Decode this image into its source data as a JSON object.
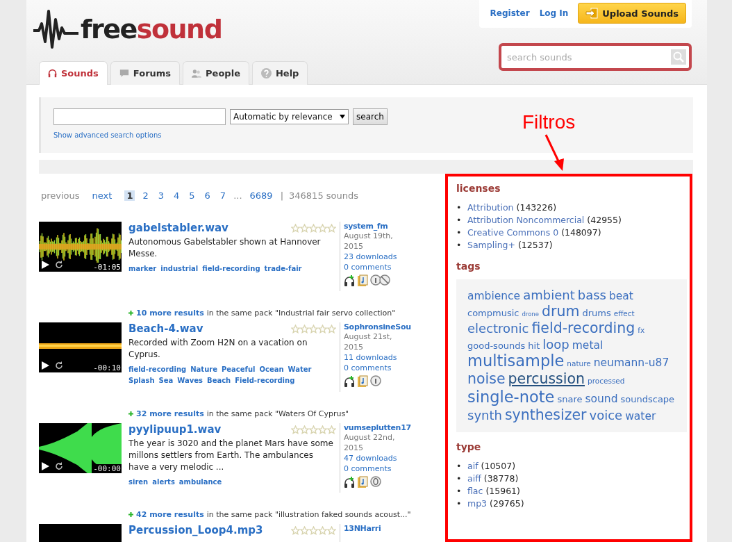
{
  "header": {
    "logo_text": "free",
    "logo_accent": "sound",
    "nav_tabs": [
      {
        "label": "Sounds",
        "selected": true
      },
      {
        "label": "Forums",
        "selected": false
      },
      {
        "label": "People",
        "selected": false
      },
      {
        "label": "Help",
        "selected": false
      }
    ],
    "account_links": [
      "Register",
      "Log In"
    ],
    "upload_button": "Upload Sounds",
    "site_search": {
      "placeholder": "search sounds"
    }
  },
  "search_panel": {
    "sort_select": "Automatic by relevance",
    "search_button": "search",
    "advanced_link": "Show advanced search options"
  },
  "pagination": {
    "previous": {
      "label": "previous",
      "disabled": true
    },
    "next": "next",
    "pages": [
      {
        "label": "1",
        "selected": true
      },
      {
        "label": "2",
        "selected": false
      },
      {
        "label": "3",
        "selected": false
      },
      {
        "label": "4",
        "selected": false
      },
      {
        "label": "5",
        "selected": false
      },
      {
        "label": "6",
        "selected": false
      },
      {
        "label": "7",
        "selected": false
      }
    ],
    "ellipsis": "...",
    "last_page": "6689",
    "separator": "|",
    "total": "346815 sounds"
  },
  "results": [
    {
      "title": "gabelstabler.wav",
      "stars": 0,
      "waveform": {
        "kind": "noisy"
      },
      "duration": "-01:05",
      "description": "Autonomous Gabelstabler shown at Hannover Messe.",
      "tags": [
        "marker",
        "industrial",
        "field-recording",
        "trade-fair"
      ],
      "user": "system_fm",
      "date": "August 19th, 2015",
      "downloads": "23 downloads",
      "comments": "0 comments",
      "license": {
        "kind": "noncommercial"
      },
      "more": {
        "count": "10 more results",
        "rest": "in the same pack \"Industrial fair servo collection\""
      }
    },
    {
      "title": "Beach-4.wav",
      "stars": 0,
      "waveform": {
        "kind": "flat"
      },
      "duration": "-00:10",
      "description": "Recorded with Zoom H2N on a vacation on Cyprus.",
      "tags": [
        "field-recording",
        "Nature",
        "Peaceful",
        "Ocean",
        "Water",
        "Splash",
        "Sea",
        "Waves",
        "Beach",
        "Field-recording"
      ],
      "user": "SophronsineSou",
      "date": "August 21st, 2015",
      "downloads": "11 downloads",
      "comments": "0 comments",
      "license": {
        "kind": "attribution"
      },
      "more": {
        "count": "32 more results",
        "rest": "in the same pack \"Waters Of Cyprus\""
      }
    },
    {
      "title": "pyylipuup1.wav",
      "stars": 0,
      "waveform": {
        "kind": "tone"
      },
      "duration": "-00:00",
      "description": "The year is 3020 and the planet Mars have some millons settlers from Earth. The ambulances have a very melodic ...",
      "tags": [
        "siren",
        "alerts",
        "ambulance"
      ],
      "user": "vumseplutten17",
      "date": "August 22nd, 2015",
      "downloads": "47 downloads",
      "comments": "0 comments",
      "license": {
        "kind": "zero"
      },
      "more": {
        "count": "42 more results",
        "rest": "in the same pack \"illustration faked sounds acoust...\""
      }
    },
    {
      "title": "Percussion_Loop4.mp3",
      "stars": 0,
      "waveform": {
        "kind": "dark"
      },
      "user": "13NHarri"
    }
  ],
  "annotation": {
    "label": "Filtros"
  },
  "filters": {
    "bullet": "•",
    "licenses": {
      "heading": "licenses",
      "items": [
        {
          "label": "Attribution",
          "count": "(143226)"
        },
        {
          "label": "Attribution Noncommercial",
          "count": "(42955)"
        },
        {
          "label": "Creative Commons 0",
          "count": "(148097)"
        },
        {
          "label": "Sampling+",
          "count": "(12537)"
        }
      ]
    },
    "tags": {
      "heading": "tags",
      "cloud": [
        {
          "label": "ambience",
          "kind": "medium",
          "hovered": false
        },
        {
          "label": "ambient",
          "kind": "large",
          "hovered": false
        },
        {
          "label": "bass",
          "kind": "large",
          "hovered": false
        },
        {
          "label": "beat",
          "kind": "medium",
          "hovered": false
        },
        {
          "label": "compmusic",
          "kind": "small",
          "hovered": false
        },
        {
          "label": "drone",
          "kind": "tiny",
          "hovered": false
        },
        {
          "label": "drum",
          "kind": "huge",
          "hovered": false
        },
        {
          "label": "drums",
          "kind": "small",
          "hovered": false
        },
        {
          "label": "effect",
          "kind": "minor",
          "hovered": false
        },
        {
          "label": "electronic",
          "kind": "large",
          "hovered": false
        },
        {
          "label": "field-recording",
          "kind": "huge",
          "hovered": false
        },
        {
          "label": "fx",
          "kind": "minor",
          "hovered": false
        },
        {
          "label": "good-sounds",
          "kind": "small",
          "hovered": false
        },
        {
          "label": "hit",
          "kind": "small",
          "hovered": false
        },
        {
          "label": "loop",
          "kind": "large",
          "hovered": false
        },
        {
          "label": "metal",
          "kind": "medium",
          "hovered": false
        },
        {
          "label": "multisample",
          "kind": "giant",
          "hovered": false
        },
        {
          "label": "nature",
          "kind": "minor",
          "hovered": false
        },
        {
          "label": "neumann-u87",
          "kind": "medium",
          "hovered": false
        },
        {
          "label": "noise",
          "kind": "huge",
          "hovered": false
        },
        {
          "label": "percussion",
          "kind": "huge",
          "hovered": true
        },
        {
          "label": "processed",
          "kind": "minor",
          "hovered": false
        },
        {
          "label": "single-note",
          "kind": "giant",
          "hovered": false
        },
        {
          "label": "snare",
          "kind": "small",
          "hovered": false
        },
        {
          "label": "sound",
          "kind": "medium",
          "hovered": false
        },
        {
          "label": "soundscape",
          "kind": "small",
          "hovered": false
        },
        {
          "label": "synth",
          "kind": "large",
          "hovered": false
        },
        {
          "label": "synthesizer",
          "kind": "huge",
          "hovered": false
        },
        {
          "label": "voice",
          "kind": "large",
          "hovered": false
        },
        {
          "label": "water",
          "kind": "medium",
          "hovered": false
        }
      ]
    },
    "type": {
      "heading": "type",
      "items": [
        {
          "label": "aif",
          "count": "(10507)"
        },
        {
          "label": "aiff",
          "count": "(38778)"
        },
        {
          "label": "flac",
          "count": "(15961)"
        },
        {
          "label": "mp3",
          "count": "(29765)"
        }
      ]
    }
  }
}
